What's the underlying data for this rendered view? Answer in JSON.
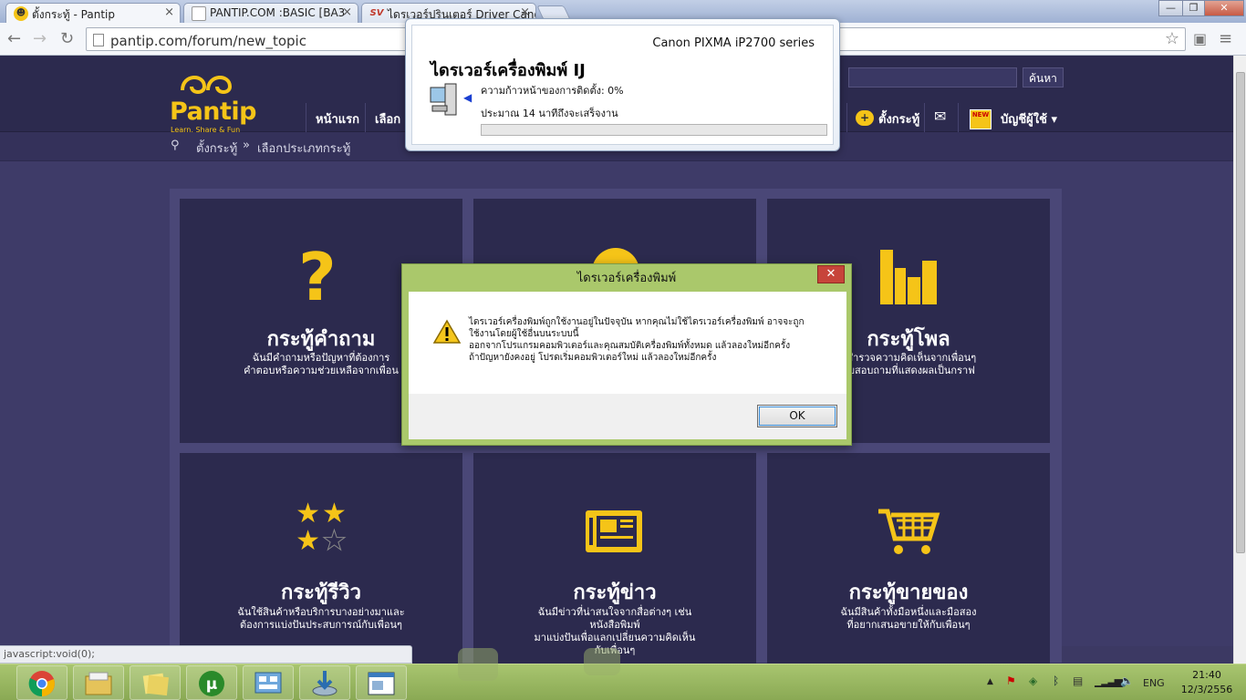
{
  "browser": {
    "tabs": [
      {
        "title": "ตั้งกระทู้ - Pantip",
        "close": "×"
      },
      {
        "title": "PANTIP.COM :BASIC [BA3",
        "close": "×"
      },
      {
        "title": "ไดรเวอร์ปรินเตอร์ Driver Cano",
        "close": "×"
      }
    ],
    "tab_icon_sv": "SV",
    "url": "pantip.com/forum/new_topic",
    "window_buttons": [
      "—",
      "❐",
      "✕"
    ]
  },
  "site": {
    "logo_text": "Pantip",
    "logo_tagline": "Learn, Share & Fun",
    "nav": [
      "หน้าแรก",
      "เลือก"
    ],
    "search_button": "ค้นหา",
    "new_topic": "ตั้งกระทู้",
    "new_badge": "NEW",
    "account": "บัญชีผู้ใช้ ▾",
    "breadcrumb": [
      "ตั้งกระทู้",
      "»",
      "เลือกประเภทกระทู้"
    ]
  },
  "cards": [
    {
      "title": "กระทู้คำถาม",
      "desc": "ฉันมีคำถามหรือปัญหาที่ต้องการ\nคำตอบหรือความช่วยเหลือจากเพื่อน",
      "icon": "question-mark-icon"
    },
    {
      "title": "",
      "desc": "",
      "icon": "discussion-icon"
    },
    {
      "title": "กระทู้โพล",
      "desc": "กสำรวจความคิดเห็นจากเพื่อนๆ\nบบสอบถามที่แสดงผลเป็นกราฟ",
      "icon": "bar-chart-icon"
    },
    {
      "title": "กระทู้รีวิว",
      "desc": "ฉันใช้สินค้าหรือบริการบางอย่างมาและ\nต้องการแบ่งปันประสบการณ์กับเพื่อนๆ",
      "icon": "stars-icon"
    },
    {
      "title": "กระทู้ข่าว",
      "desc": "ฉันมีข่าวที่น่าสนใจจากสื่อต่างๆ เช่น\nหนังสือพิมพ์\nมาแบ่งปันเพื่อแลกเปลี่ยนความคิดเห็น\nกับเพื่อนๆ",
      "icon": "newspaper-icon"
    },
    {
      "title": "กระทู้ขายของ",
      "desc": "ฉันมีสินค้าทั้งมือหนึ่งและมือสอง\nที่อยากเสนอขายให้กับเพื่อนๆ",
      "icon": "shopping-cart-icon"
    }
  ],
  "status_bar": "javascript:void(0);",
  "progress_dialog": {
    "model": "Canon PIXMA iP2700 series",
    "title": "ไดรเวอร์เครื่องพิมพ์ IJ",
    "progress_label": "ความก้าวหน้าของการติดตั้ง: 0%",
    "progress_value": 0,
    "eta": "ประมาณ 14 นาทีถึงจะเสร็จงาน"
  },
  "error_dialog": {
    "title": "ไดรเวอร์เครื่องพิมพ์",
    "close": "✕",
    "message": "ไดรเวอร์เครื่องพิมพ์ถูกใช้งานอยู่ในปัจจุบัน หากคุณไม่ใช้ไดรเวอร์เครื่องพิมพ์ อาจจะถูก\nใช้งานโดยผู้ใช้อื่นบนระบบนี้\nออกจากโปรแกรมคอมพิวเตอร์และคุณสมบัติเครื่องพิมพ์ทั้งหมด แล้วลองใหม่อีกครั้ง\nถ้าปัญหายังคงอยู่ โปรดเริ่มคอมพิวเตอร์ใหม่ แล้วลองใหม่อีกครั้ง",
    "ok": "OK"
  },
  "taskbar": {
    "apps": [
      "chrome-icon",
      "file-explorer-icon",
      "folder-icon",
      "utorrent-icon",
      "control-panel-icon",
      "installer-icon",
      "window-icon"
    ],
    "language": "ENG",
    "time": "21:40",
    "date": "12/3/2556",
    "tray_arrow": "▲"
  },
  "colors": {
    "accent": "#f5c418",
    "header_bg": "#2c2a4e",
    "taskbar": "#9bb964"
  }
}
